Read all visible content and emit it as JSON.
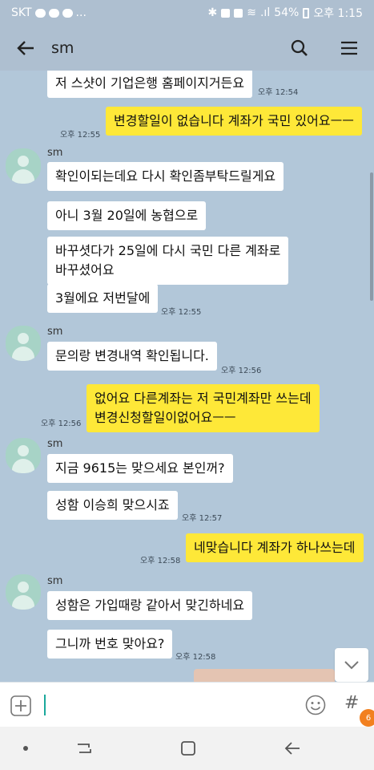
{
  "status_bar": {
    "carrier": "SKT",
    "dots": "...",
    "battery": "54%",
    "time": "오후 1:15"
  },
  "app_bar": {
    "title": "sm"
  },
  "icons": {
    "back": "arrow-left-icon",
    "search": "search-icon",
    "menu": "hamburger-menu-icon",
    "plus": "plus-icon",
    "emoji": "emoji-icon",
    "hash": "hash-icon",
    "scroll_down": "chevron-down-icon"
  },
  "colors": {
    "chat_bg": "#b2c7d9",
    "header_bg": "#aebfd0",
    "my_bubble": "#fee838",
    "their_bubble": "#ffffff",
    "avatar_bg": "#a7d3c6",
    "badge": "#f2801f"
  },
  "messages": [
    {
      "side": "in",
      "text": "저 스샷이 기업은행 홈페이지거든요",
      "time": "오후 12:54"
    },
    {
      "side": "out",
      "text": "변경할일이 없습니다 계좌가 국민 있어요ㅡㅡ",
      "time": "오후 12:55"
    },
    {
      "side": "in",
      "sender": "sm",
      "text": "확인이되는데요 다시 확인좀부탁드릴게요"
    },
    {
      "side": "in",
      "text": "아니 3월 20일에 농협으로"
    },
    {
      "side": "in",
      "text_lines": [
        "바꾸셧다가 25일에 다시 국민 다른 계좌로",
        "바꾸셨어요"
      ]
    },
    {
      "side": "in",
      "text": "3월에요 저번달에",
      "time": "오후 12:55"
    },
    {
      "side": "in",
      "sender": "sm",
      "text": "문의랑 변경내역 확인됩니다.",
      "time": "오후 12:56"
    },
    {
      "side": "out",
      "text_lines": [
        "없어요 다른계좌는 저 국민계좌만 쓰는데",
        "변경신청할일이없어요ㅡㅡ"
      ],
      "time": "오후 12:56"
    },
    {
      "side": "in",
      "sender": "sm",
      "text": "지금 9615는 맞으세요 본인꺼?"
    },
    {
      "side": "in",
      "text": "성함 이승희 맞으시죠",
      "time": "오후 12:57"
    },
    {
      "side": "out",
      "text": "네맞습니다 계좌가 하나쓰는데",
      "time": "오후 12:58"
    },
    {
      "side": "in",
      "sender": "sm",
      "text": "성함은 가입때랑 같아서 맞긴하네요"
    },
    {
      "side": "in",
      "text": "그니까 번호 맞아요?",
      "time": "오후 12:58"
    }
  ],
  "input": {
    "value": "",
    "placeholder": ""
  },
  "badge_text": "6"
}
